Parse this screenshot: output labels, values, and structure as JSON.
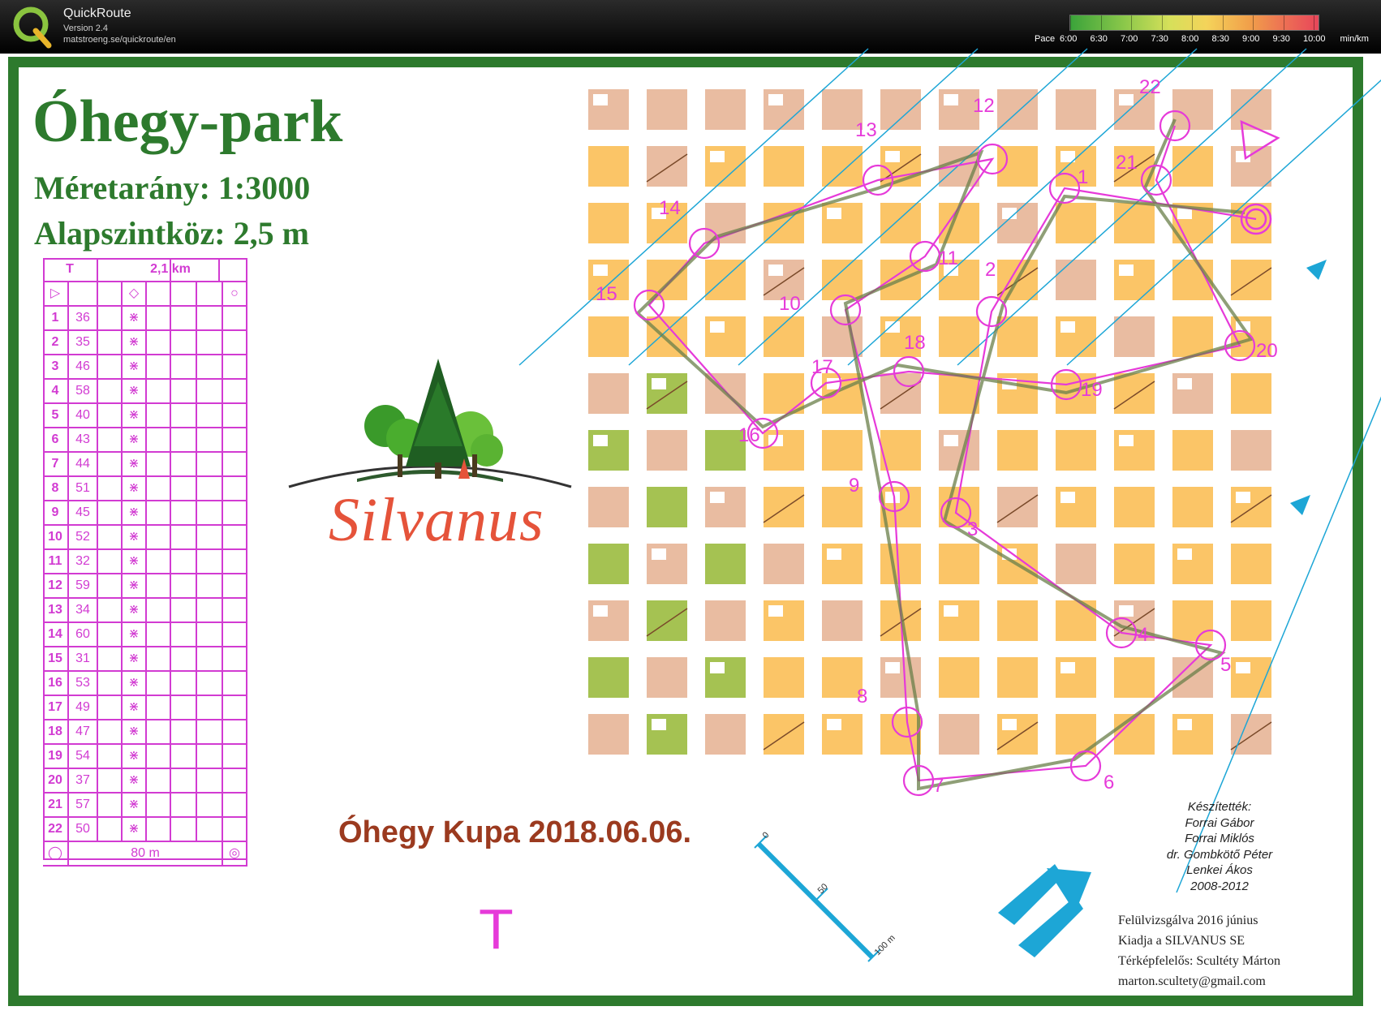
{
  "app": {
    "name": "QuickRoute",
    "version": "Version 2.4",
    "url": "matstroeng.se/quickroute/en",
    "logo_letter": "Q"
  },
  "pace_scale": {
    "label": "Pace",
    "ticks": [
      "6:00",
      "6:30",
      "7:00",
      "7:30",
      "8:00",
      "8:30",
      "9:00",
      "9:30",
      "10:00"
    ],
    "unit": "min/km"
  },
  "map": {
    "title": "Óhegy-park",
    "scale": "Méretarány: 1:3000",
    "contour": "Alapszintköz: 2,5 m",
    "event": "Óhegy Kupa 2018.06.06.",
    "start_symbol": "T",
    "colors": {
      "frame": "#2d7a2d",
      "course": "#e63ad9",
      "route": "#6a7f4a",
      "open": "#fbbf57",
      "paved": "#e7b597",
      "forest": "#9bbb3f"
    }
  },
  "control_table": {
    "header": {
      "start_code": "T",
      "length": "2,1 km"
    },
    "controls": [
      {
        "n": "1",
        "code": "36"
      },
      {
        "n": "2",
        "code": "35"
      },
      {
        "n": "3",
        "code": "46"
      },
      {
        "n": "4",
        "code": "58"
      },
      {
        "n": "5",
        "code": "40"
      },
      {
        "n": "6",
        "code": "43"
      },
      {
        "n": "7",
        "code": "44"
      },
      {
        "n": "8",
        "code": "51"
      },
      {
        "n": "9",
        "code": "45"
      },
      {
        "n": "10",
        "code": "52"
      },
      {
        "n": "11",
        "code": "32"
      },
      {
        "n": "12",
        "code": "59"
      },
      {
        "n": "13",
        "code": "34"
      },
      {
        "n": "14",
        "code": "60"
      },
      {
        "n": "15",
        "code": "31"
      },
      {
        "n": "16",
        "code": "53"
      },
      {
        "n": "17",
        "code": "49"
      },
      {
        "n": "18",
        "code": "47"
      },
      {
        "n": "19",
        "code": "54"
      },
      {
        "n": "20",
        "code": "37"
      },
      {
        "n": "21",
        "code": "57"
      },
      {
        "n": "22",
        "code": "50"
      }
    ],
    "finish_distance": "80 m"
  },
  "sponsor": {
    "name": "Silvanus"
  },
  "credits": {
    "heading": "Készítették:",
    "names": [
      "Forrai Gábor",
      "Forrai Miklós",
      "dr. Gombkötő Péter",
      "Lenkei Ákos",
      "2008-2012"
    ]
  },
  "review": [
    "Felülvizsgálva 2016 június",
    "Kiadja a SILVANUS  SE",
    "Térképfelelős: Scultéty Márton",
    "marton.scultety@gmail.com"
  ],
  "scale_bar": {
    "labels": [
      "0",
      "50",
      "100 m"
    ]
  },
  "controls_on_map": [
    {
      "n": "1"
    },
    {
      "n": "2"
    },
    {
      "n": "3"
    },
    {
      "n": "4"
    },
    {
      "n": "5"
    },
    {
      "n": "6"
    },
    {
      "n": "7"
    },
    {
      "n": "8"
    },
    {
      "n": "9"
    },
    {
      "n": "10"
    },
    {
      "n": "11"
    },
    {
      "n": "12"
    },
    {
      "n": "13"
    },
    {
      "n": "14"
    },
    {
      "n": "15"
    },
    {
      "n": "16"
    },
    {
      "n": "17"
    },
    {
      "n": "18"
    },
    {
      "n": "19"
    },
    {
      "n": "20"
    },
    {
      "n": "21"
    },
    {
      "n": "22"
    }
  ]
}
